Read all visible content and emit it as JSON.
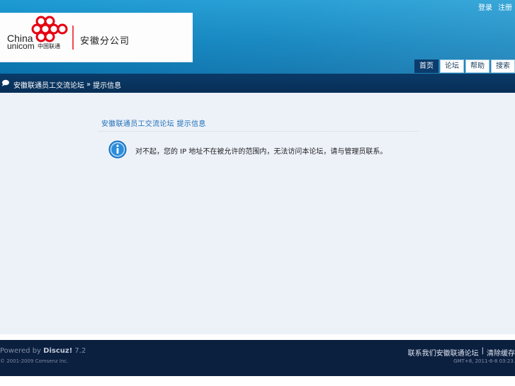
{
  "header": {
    "top_links": [
      "登录",
      "注册"
    ],
    "logo": {
      "brand_en_line1": "China",
      "brand_en_line2": "unicom",
      "brand_cn": "中国联通",
      "branch_name": "安徽分公司"
    },
    "nav_tabs": [
      {
        "label": "首页",
        "active": true
      },
      {
        "label": "论坛",
        "active": false
      },
      {
        "label": "帮助",
        "active": false
      },
      {
        "label": "搜索",
        "active": false
      }
    ]
  },
  "breadcrumb": {
    "items": [
      "安徽联通员工交流论坛",
      "»",
      "提示信息"
    ]
  },
  "message": {
    "title": "安徽联通员工交流论坛 提示信息",
    "text": "对不起，您的 IP 地址不在被允许的范围内，无法访问本论坛，请与管理员联系。"
  },
  "footer": {
    "powered_prefix": "Powered by ",
    "powered_brand": "Discuz!",
    "powered_version": " 7.2",
    "copyright": "© 2001-2009 Comsenz Inc.",
    "links": [
      "联系我们安徽联通论坛",
      "|",
      "清除缓存"
    ],
    "time": "GMT+8, 2011-6-8 03:23."
  },
  "colors": {
    "header_blue": "#1e9bd3",
    "dark_navy": "#0b3a68",
    "footer_navy": "#0b1f3f",
    "brand_red": "#e60012",
    "title_blue": "#1f6db8",
    "info_blue": "#2b8cdc"
  },
  "icons": {
    "logo": "china-unicom-knot-icon",
    "breadcrumb": "speech-bubble-icon",
    "message": "info-icon"
  }
}
